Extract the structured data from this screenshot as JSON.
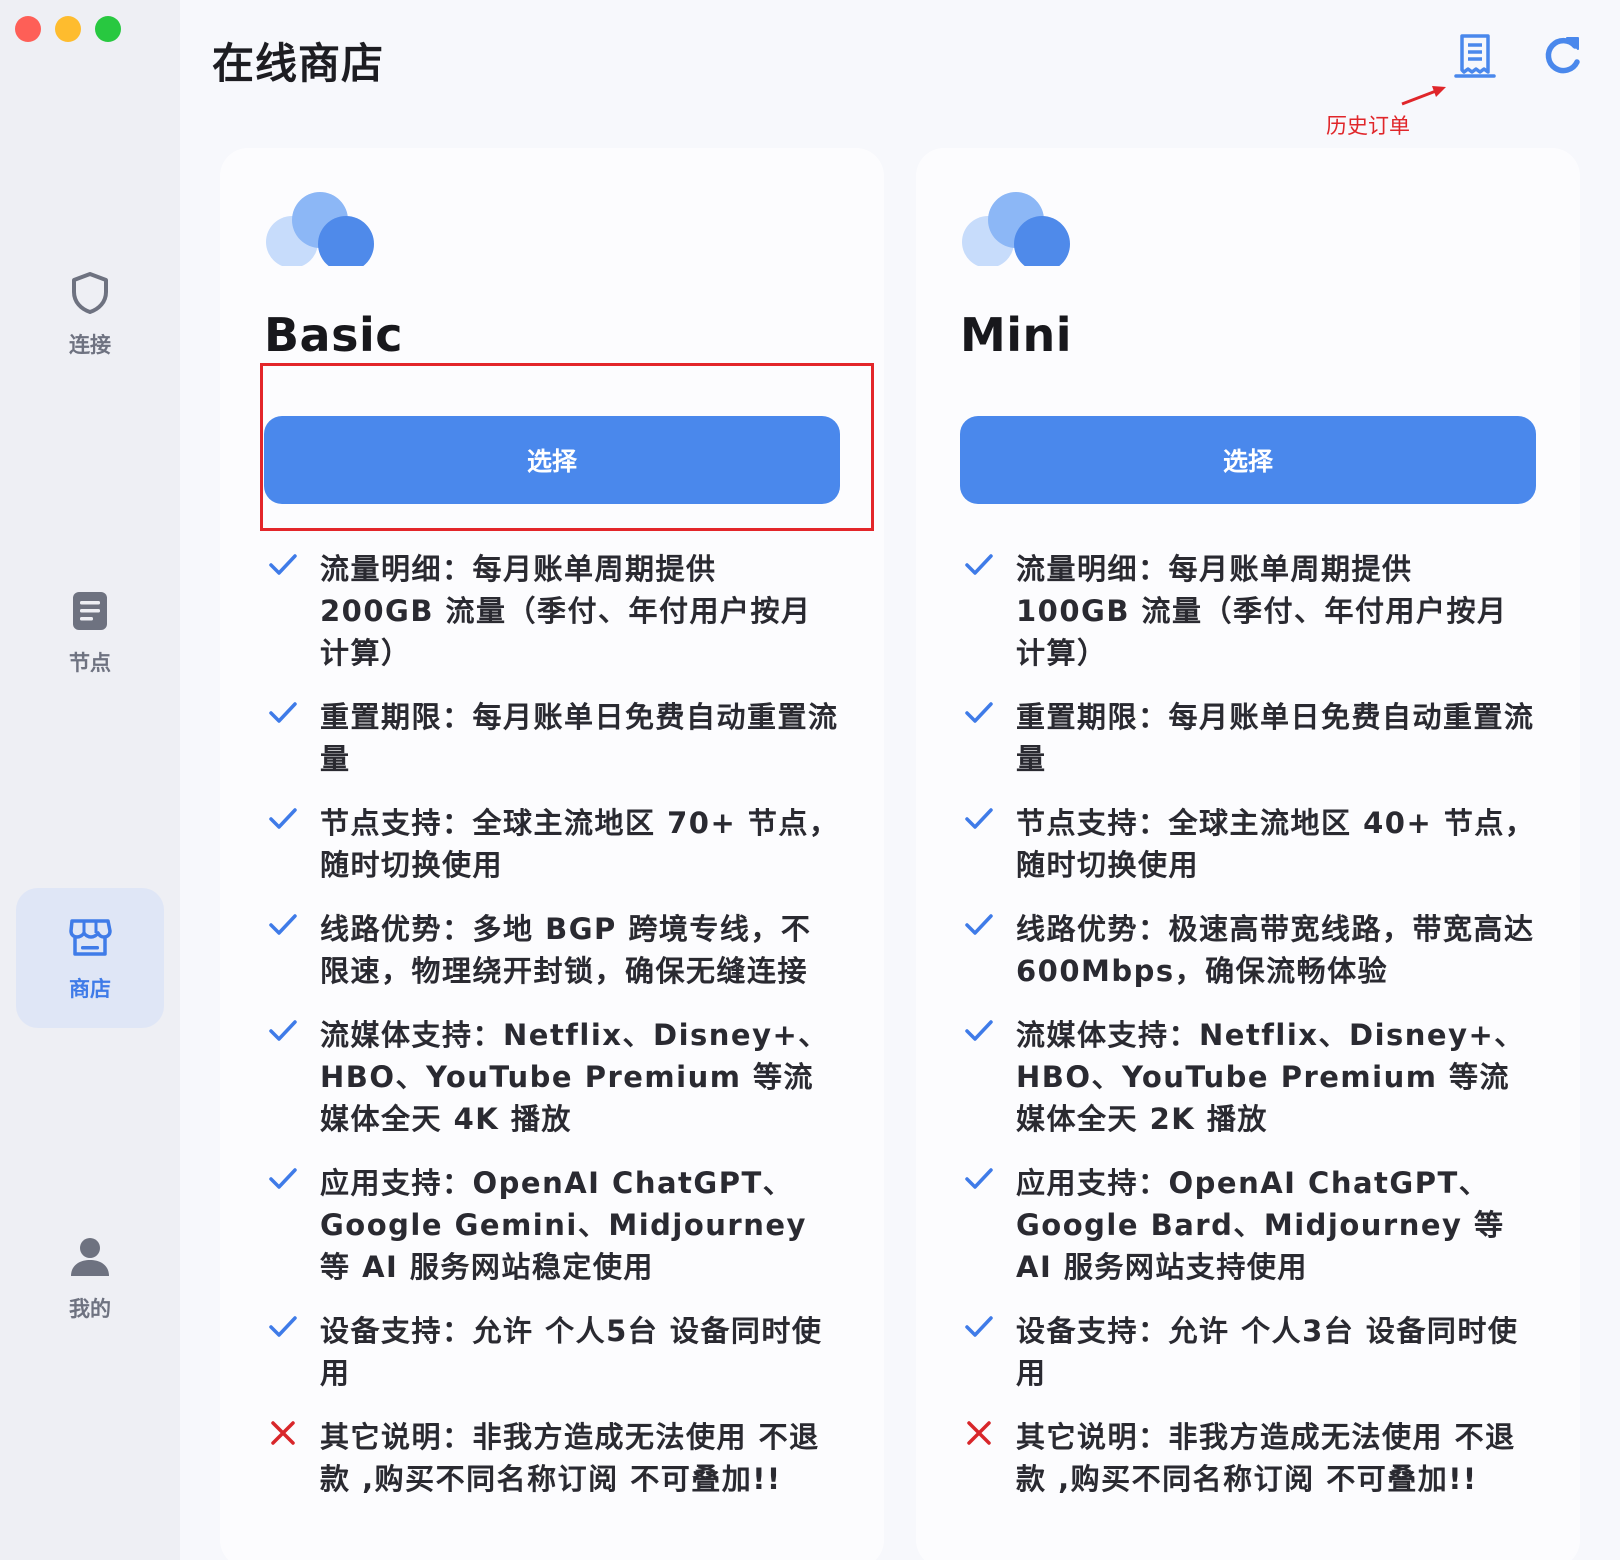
{
  "app": {
    "title": "在线商店"
  },
  "colors": {
    "accent": "#4a88ec",
    "check": "#3f7be8",
    "cross": "#d8262a",
    "annotation": "#e0262a"
  },
  "sidebar": {
    "items": [
      {
        "label": "连接",
        "icon": "shield-icon",
        "active": false
      },
      {
        "label": "节点",
        "icon": "document-icon",
        "active": false
      },
      {
        "label": "商店",
        "icon": "store-icon",
        "active": true
      },
      {
        "label": "我的",
        "icon": "person-icon",
        "active": false
      }
    ]
  },
  "header": {
    "orders_icon": "receipt-icon",
    "refresh_icon": "refresh-icon",
    "annotation": "历史订单"
  },
  "plans": [
    {
      "name": "Basic",
      "button": "选择",
      "highlighted": true,
      "features": [
        {
          "type": "check",
          "text": "流量明细：每月账单周期提供 200GB 流量（季付、年付用户按月计算）"
        },
        {
          "type": "check",
          "text": "重置期限：每月账单日免费自动重置流量"
        },
        {
          "type": "check",
          "text": "节点支持：全球主流地区 70+ 节点，随时切换使用"
        },
        {
          "type": "check",
          "text": "线路优势：多地 BGP 跨境专线，不限速，物理绕开封锁，确保无缝连接"
        },
        {
          "type": "check",
          "text": "流媒体支持：Netflix、Disney+、HBO、YouTube Premium 等流媒体全天 4K 播放"
        },
        {
          "type": "check",
          "text": "应用支持：OpenAI ChatGPT、Google Gemini、Midjourney 等 AI 服务网站稳定使用"
        },
        {
          "type": "check",
          "text": "设备支持：允许 个人5台 设备同时使用"
        },
        {
          "type": "cross",
          "text": "其它说明：非我方造成无法使用 不退款 ,购买不同名称订阅 不可叠加!!"
        }
      ]
    },
    {
      "name": "Mini",
      "button": "选择",
      "highlighted": false,
      "features": [
        {
          "type": "check",
          "text": "流量明细：每月账单周期提供 100GB 流量（季付、年付用户按月计算）"
        },
        {
          "type": "check",
          "text": "重置期限：每月账单日免费自动重置流量"
        },
        {
          "type": "check",
          "text": "节点支持：全球主流地区 40+ 节点，随时切换使用"
        },
        {
          "type": "check",
          "text": "线路优势：极速高带宽线路，带宽高达 600Mbps，确保流畅体验"
        },
        {
          "type": "check",
          "text": "流媒体支持：Netflix、Disney+、HBO、YouTube Premium 等流媒体全天 2K 播放"
        },
        {
          "type": "check",
          "text": "应用支持：OpenAI ChatGPT、Google Bard、Midjourney 等 AI 服务网站支持使用"
        },
        {
          "type": "check",
          "text": "设备支持：允许 个人3台 设备同时使用"
        },
        {
          "type": "cross",
          "text": "其它说明：非我方造成无法使用 不退款 ,购买不同名称订阅 不可叠加!!"
        }
      ]
    }
  ]
}
